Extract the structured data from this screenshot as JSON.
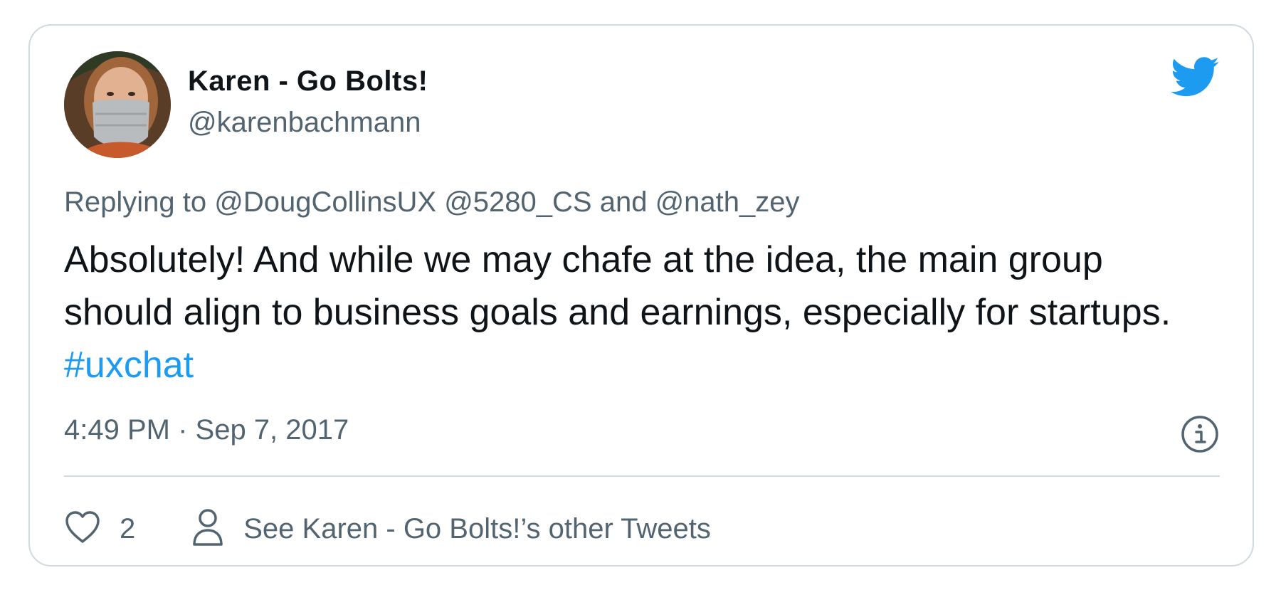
{
  "tweet": {
    "author": {
      "display_name": "Karen - Go Bolts!",
      "handle": "@karenbachmann",
      "avatar_icon": "profile-photo"
    },
    "reply": {
      "prefix": "Replying to ",
      "mention_1": "@DougCollinsUX",
      "mention_2": "@5280_CS",
      "joiner": " and ",
      "mention_3": "@nath_zey"
    },
    "text": {
      "body": "Absolutely! And while we may chafe at the idea, the main group should align to business goals and earnings, especially for startups. ",
      "hashtag": "#uxchat"
    },
    "timestamp": "4:49 PM · Sep 7, 2017",
    "actions": {
      "like_count": "2",
      "other_tweets_label": "See Karen - Go Bolts!’s other Tweets"
    },
    "icons": {
      "logo": "twitter-bird-icon",
      "info": "info-icon",
      "like": "heart-icon",
      "profile": "person-icon"
    },
    "colors": {
      "brand": "#1d9bf0",
      "text": "#0f1419",
      "secondary": "#536471",
      "border": "#cfd9de"
    }
  }
}
